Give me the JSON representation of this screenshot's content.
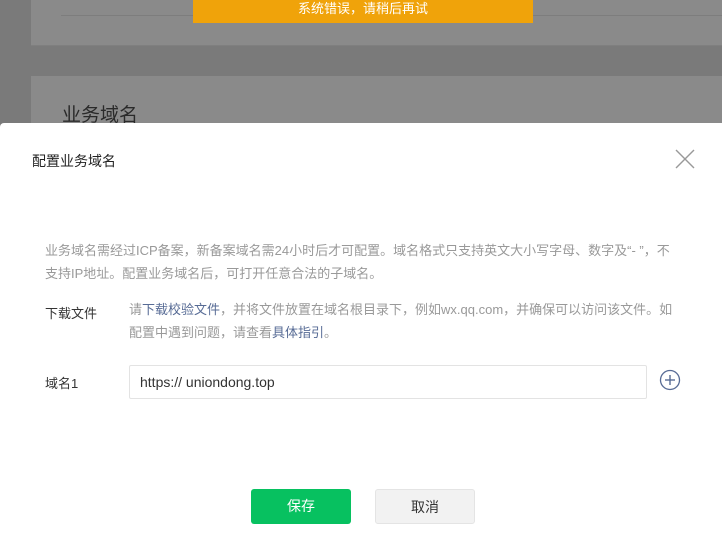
{
  "toast": {
    "text": "系统错误，请稍后再试"
  },
  "background": {
    "section_title": "业务域名"
  },
  "dialog": {
    "title": "配置业务域名",
    "description": "业务域名需经过ICP备案，新备案域名需24小时后才可配置。域名格式只支持英文大小写字母、数字及“- ”，不支持IP地址。配置业务域名后，可打开任意合法的子域名。",
    "download": {
      "label": "下载文件",
      "prefix": "请",
      "link1": "下载校验文件",
      "middle": "，并将文件放置在域名根目录下，例如wx.qq.com，并确保可以访问该文件。如配置中遇到问题，请查看",
      "link2": "具体指引",
      "suffix": "。"
    },
    "domain": {
      "label": "域名1",
      "value": "https:// uniondong.top"
    },
    "buttons": {
      "save": "保存",
      "cancel": "取消"
    }
  },
  "colors": {
    "primary": "#07c160",
    "toast": "#f0a30a",
    "link": "#576b95"
  },
  "icons": {
    "close": "close-icon",
    "add": "plus-circle-icon"
  }
}
